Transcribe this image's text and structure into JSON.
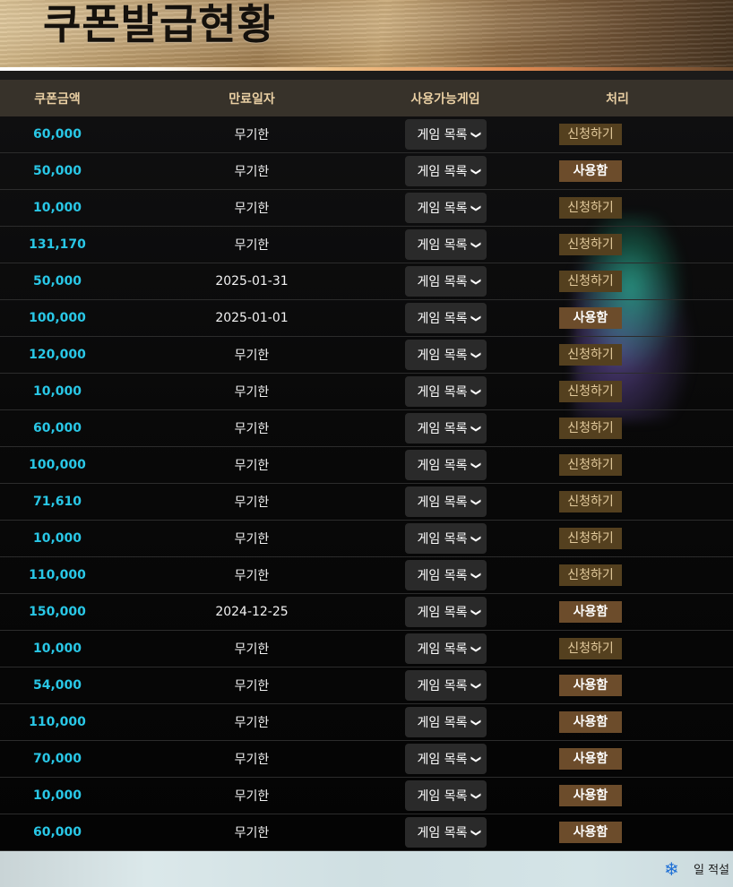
{
  "header": {
    "title": "쿠폰발급현황"
  },
  "table": {
    "columns": [
      "쿠폰금액",
      "만료일자",
      "사용가능게임",
      "처리"
    ],
    "rows": [
      {
        "amount": "60,000",
        "expiry": "무기한",
        "game": "게임 목록",
        "action": "신청하기",
        "status": "apply"
      },
      {
        "amount": "50,000",
        "expiry": "무기한",
        "game": "게임 목록",
        "action": "사용함",
        "status": "used"
      },
      {
        "amount": "10,000",
        "expiry": "무기한",
        "game": "게임 목록",
        "action": "신청하기",
        "status": "apply"
      },
      {
        "amount": "131,170",
        "expiry": "무기한",
        "game": "게임 목록",
        "action": "신청하기",
        "status": "apply"
      },
      {
        "amount": "50,000",
        "expiry": "2025-01-31",
        "game": "게임 목록",
        "action": "신청하기",
        "status": "apply"
      },
      {
        "amount": "100,000",
        "expiry": "2025-01-01",
        "game": "게임 목록",
        "action": "사용함",
        "status": "used"
      },
      {
        "amount": "120,000",
        "expiry": "무기한",
        "game": "게임 목록",
        "action": "신청하기",
        "status": "apply"
      },
      {
        "amount": "10,000",
        "expiry": "무기한",
        "game": "게임 목록",
        "action": "신청하기",
        "status": "apply"
      },
      {
        "amount": "60,000",
        "expiry": "무기한",
        "game": "게임 목록",
        "action": "신청하기",
        "status": "apply"
      },
      {
        "amount": "100,000",
        "expiry": "무기한",
        "game": "게임 목록",
        "action": "신청하기",
        "status": "apply"
      },
      {
        "amount": "71,610",
        "expiry": "무기한",
        "game": "게임 목록",
        "action": "신청하기",
        "status": "apply"
      },
      {
        "amount": "10,000",
        "expiry": "무기한",
        "game": "게임 목록",
        "action": "신청하기",
        "status": "apply"
      },
      {
        "amount": "110,000",
        "expiry": "무기한",
        "game": "게임 목록",
        "action": "신청하기",
        "status": "apply"
      },
      {
        "amount": "150,000",
        "expiry": "2024-12-25",
        "game": "게임 목록",
        "action": "사용함",
        "status": "used"
      },
      {
        "amount": "10,000",
        "expiry": "무기한",
        "game": "게임 목록",
        "action": "신청하기",
        "status": "apply"
      },
      {
        "amount": "54,000",
        "expiry": "무기한",
        "game": "게임 목록",
        "action": "사용함",
        "status": "used"
      },
      {
        "amount": "110,000",
        "expiry": "무기한",
        "game": "게임 목록",
        "action": "사용함",
        "status": "used"
      },
      {
        "amount": "70,000",
        "expiry": "무기한",
        "game": "게임 목록",
        "action": "사용함",
        "status": "used"
      },
      {
        "amount": "10,000",
        "expiry": "무기한",
        "game": "게임 목록",
        "action": "사용함",
        "status": "used"
      },
      {
        "amount": "60,000",
        "expiry": "무기한",
        "game": "게임 목록",
        "action": "사용함",
        "status": "used"
      }
    ]
  },
  "footer": {
    "icon": "snowflake-icon",
    "text": "일 적설"
  },
  "colors": {
    "amount": "#29c7e6",
    "header_bg": "#37322a",
    "header_text": "#e9cfa3",
    "apply_btn_bg": "#54401f",
    "used_btn_bg": "#6c4c2b"
  }
}
